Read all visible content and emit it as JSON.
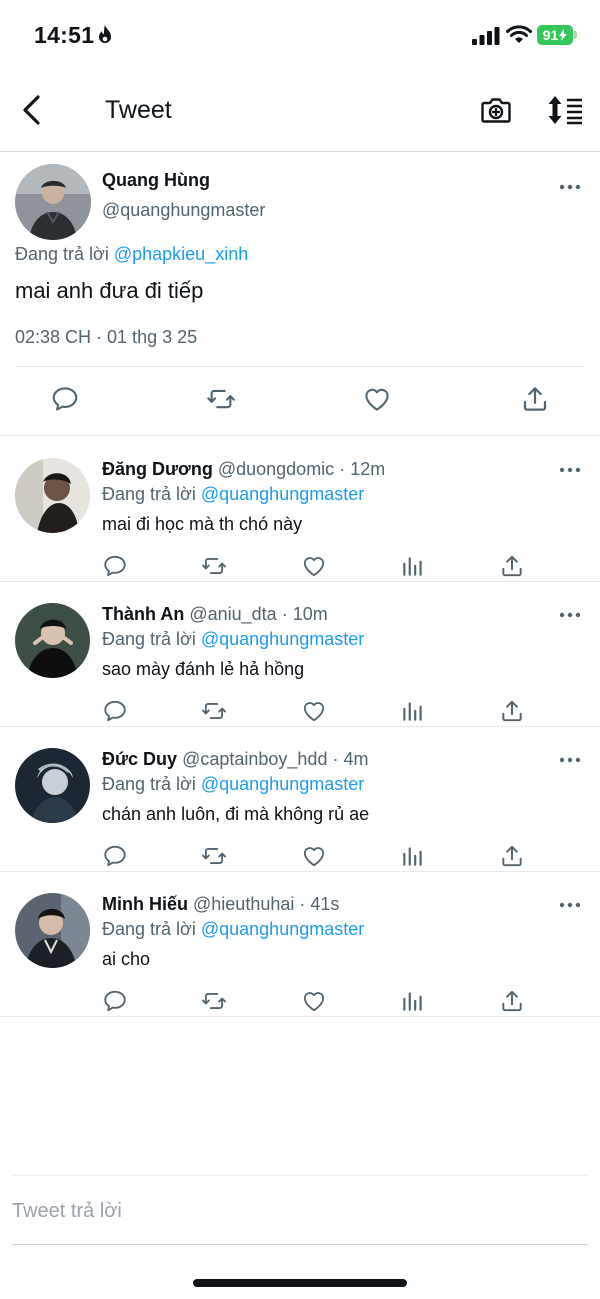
{
  "status_bar": {
    "time": "14:51",
    "battery": "91"
  },
  "nav": {
    "title": "Tweet"
  },
  "main_tweet": {
    "name": "Quang Hùng",
    "handle": "@quanghungmaster",
    "reply_prefix": "Đang trả lời",
    "reply_mention": "@phapkieu_xinh",
    "text": "mai anh đưa đi tiếp",
    "meta": "02:38 CH · 01 thg 3 25"
  },
  "replies": [
    {
      "name": "Đăng Dương",
      "handle": "@duongdomic",
      "time": "· 12m",
      "reply_prefix": "Đang trả lời",
      "mention": "@quanghungmaster",
      "text": "mai đi học mà th chó này"
    },
    {
      "name": "Thành An",
      "handle": "@aniu_dta",
      "time": "· 10m",
      "reply_prefix": "Đang trả lời",
      "mention": "@quanghungmaster",
      "text": "sao mày đánh lẻ hả hồng"
    },
    {
      "name": "Đức Duy",
      "handle": "@captainboy_hdd",
      "time": "· 4m",
      "reply_prefix": "Đang trả lời",
      "mention": "@quanghungmaster",
      "text": "chán anh luôn, đi mà không rủ ae"
    },
    {
      "name": "Minh Hiếu",
      "handle": "@hieuthuhai",
      "time": "· 41s",
      "reply_prefix": "Đang trả lời",
      "mention": "@quanghungmaster",
      "text": "ai cho"
    }
  ],
  "compose": {
    "placeholder": "Tweet trả lời"
  },
  "colors": {
    "accent": "#1d9bf0",
    "secondary_text": "#536471",
    "battery": "#34c759"
  },
  "icons": [
    "back-arrow-icon",
    "camera-icon",
    "sort-icon",
    "more-icon",
    "reply-icon",
    "retweet-icon",
    "like-icon",
    "views-icon",
    "share-icon"
  ]
}
